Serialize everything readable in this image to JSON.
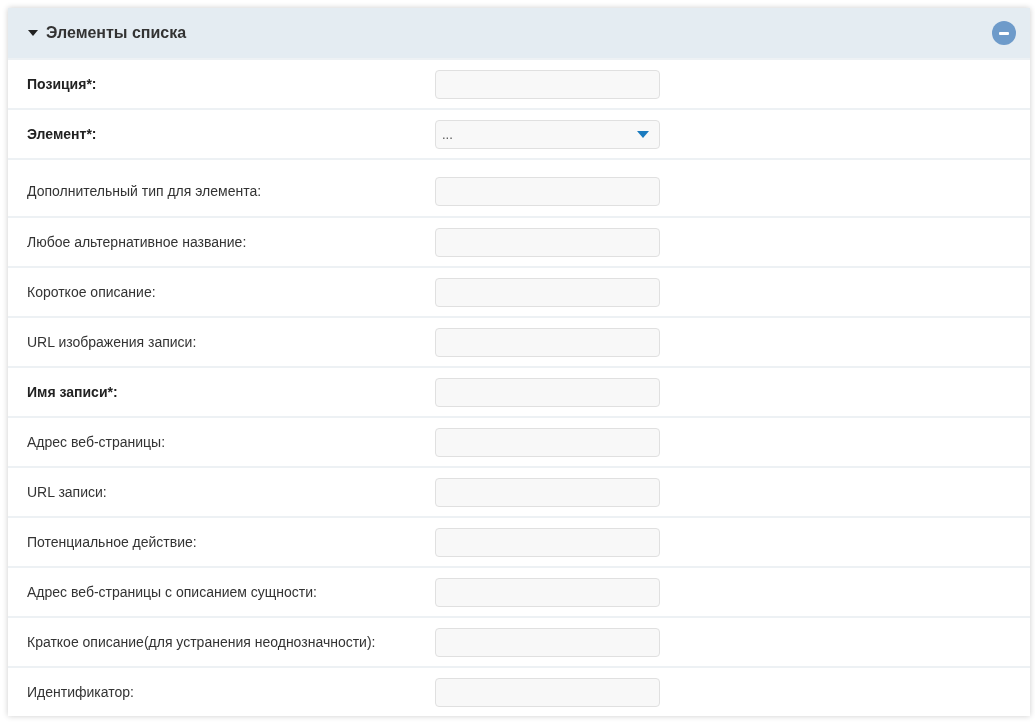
{
  "panel": {
    "title": "Элементы списка",
    "expanded": true
  },
  "fields": [
    {
      "label": "Позиция*:",
      "required": true,
      "kind": "text"
    },
    {
      "label": "Элемент*:",
      "required": true,
      "kind": "select",
      "value": "..."
    },
    {
      "label": "Дополнительный тип для элемента:",
      "required": false,
      "kind": "text"
    },
    {
      "label": "Любое альтернативное название:",
      "required": false,
      "kind": "text"
    },
    {
      "label": "Короткое описание:",
      "required": false,
      "kind": "text"
    },
    {
      "label": "URL изображения записи:",
      "required": false,
      "kind": "text"
    },
    {
      "label": "Имя записи*:",
      "required": true,
      "kind": "text"
    },
    {
      "label": "Адрес веб-страницы:",
      "required": false,
      "kind": "text"
    },
    {
      "label": "URL записи:",
      "required": false,
      "kind": "text"
    },
    {
      "label": "Потенциальное действие:",
      "required": false,
      "kind": "text"
    },
    {
      "label": "Адрес веб-страницы с описанием сущности:",
      "required": false,
      "kind": "text"
    },
    {
      "label": "Краткое описание(для устранения неоднозначности):",
      "required": false,
      "kind": "text"
    },
    {
      "label": "Идентификатор:",
      "required": false,
      "kind": "text"
    }
  ]
}
